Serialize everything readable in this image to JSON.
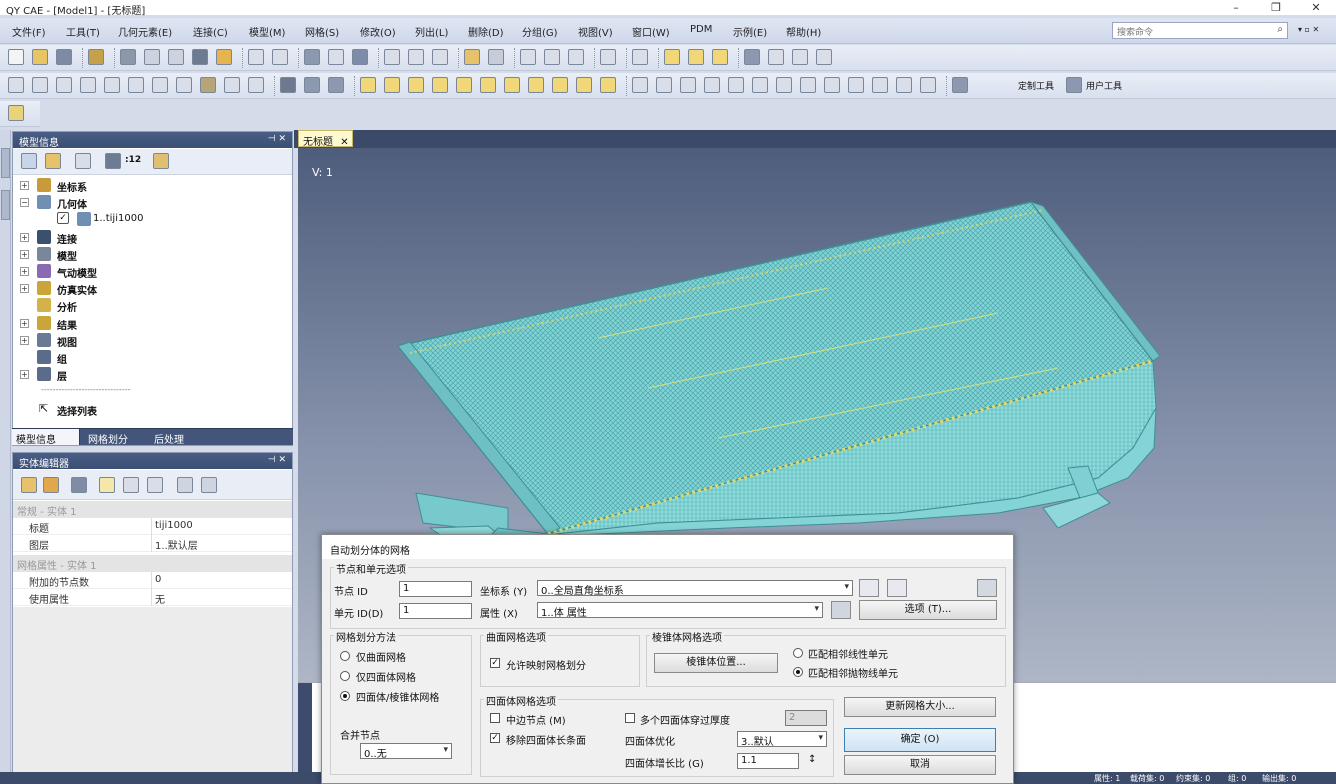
{
  "window": {
    "title": "QY CAE - [Model1] - [无标题]",
    "minimize": "–",
    "maximize": "❐",
    "close": "✕"
  },
  "menu": {
    "items": [
      "文件(F)",
      "工具(T)",
      "几何元素(E)",
      "连接(C)",
      "模型(M)",
      "网格(S)",
      "修改(O)",
      "列出(L)",
      "删除(D)",
      "分组(G)",
      "视图(V)",
      "窗口(W)",
      "PDM",
      "示例(E)",
      "帮助(H)"
    ],
    "search_placeholder": "搜索命令",
    "search_icon": "magnifier-icon",
    "mdi_controls": "▾ ▫ ✕"
  },
  "toolbar3": {
    "custom_tools": "定制工具",
    "user_tools": "用户工具"
  },
  "model_panel": {
    "title": "模型信息",
    "pin": "⊣ ✕",
    "count_label": ":12",
    "tree": [
      {
        "label": "坐标系",
        "exp": "+"
      },
      {
        "label": "几何体",
        "exp": "−"
      },
      {
        "label": "1..tiji1000",
        "exp": ""
      },
      {
        "label": "连接",
        "exp": "+"
      },
      {
        "label": "模型",
        "exp": "+"
      },
      {
        "label": "气动模型",
        "exp": "+"
      },
      {
        "label": "仿真实体",
        "exp": "+"
      },
      {
        "label": "分析",
        "exp": ""
      },
      {
        "label": "结果",
        "exp": "+"
      },
      {
        "label": "视图",
        "exp": "+"
      },
      {
        "label": "组",
        "exp": ""
      },
      {
        "label": "层",
        "exp": "+"
      },
      {
        "label": "-------------------------------",
        "exp": ""
      },
      {
        "label": "选择列表",
        "exp": ""
      }
    ],
    "tabs": [
      "模型信息",
      "网格划分",
      "后处理"
    ]
  },
  "entity_panel": {
    "title": "实体编辑器",
    "pin": "⊣ ✕",
    "sections": [
      "常规 - 实体 1",
      "网格属性 - 实体 1"
    ],
    "rows": [
      {
        "k": "标题",
        "v": "tiji1000"
      },
      {
        "k": "图层",
        "v": "1..默认层"
      },
      {
        "k": "附加的节点数",
        "v": "0"
      },
      {
        "k": "使用属性",
        "v": "无"
      }
    ]
  },
  "doc_tab": {
    "label": "无标题",
    "close": "✕"
  },
  "viewport": {
    "label": "V: 1"
  },
  "status": {
    "props": "属性: 1",
    "loads": "载荷集: 0",
    "constraints": "约束集: 0",
    "groups": "组: 0",
    "output": "输出集: 0"
  },
  "dialog": {
    "title": "自动划分体的网格",
    "node_group": "节点和单元选项",
    "node_id_label": "节点 ID",
    "node_id": "1",
    "coord_label": "坐标系 (Y)",
    "coord_value": "0..全局直角坐标系",
    "elem_id_label": "单元 ID(D)",
    "elem_id": "1",
    "prop_label": "属性 (X)",
    "prop_value": "1..体 属性",
    "options_btn": "选项 (T)...",
    "mesh_method_group": "网格划分方法",
    "method_surface": "仅曲面网格",
    "method_tet": "仅四面体网格",
    "method_tet_pyr": "四面体/棱锥体网格",
    "merge_nodes_label": "合并节点",
    "merge_nodes_value": "0..无",
    "surface_mesh_group": "曲面网格选项",
    "allow_mapped": "允许映射网格划分",
    "pyramid_group": "棱锥体网格选项",
    "pyramid_pos_btn": "棱锥体位置...",
    "match_linear": "匹配相邻线性单元",
    "match_parabolic": "匹配相邻抛物线单元",
    "tet_group": "四面体网格选项",
    "midside_nodes": "中边节点 (M)",
    "remove_long": "移除四面体长条面",
    "multi_tet": "多个四面体穿过厚度",
    "multi_tet_value": "2",
    "tet_opt_label": "四面体优化",
    "tet_opt_value": "3..默认",
    "growth_label": "四面体增长比 (G)",
    "growth_value": "1.1",
    "update_size_btn": "更新网格大小...",
    "ok_btn": "确定 (O)",
    "cancel_btn": "取消"
  }
}
